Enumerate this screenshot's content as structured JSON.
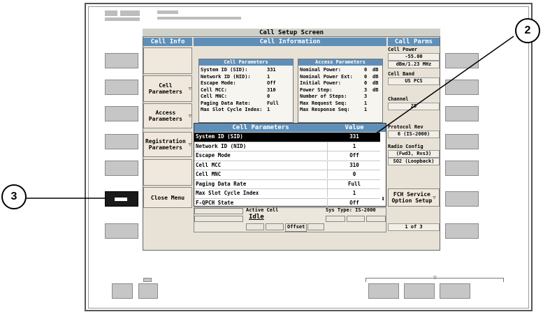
{
  "screen_title": "Call Setup Screen",
  "left_header": "Cell Info",
  "center_header": "Cell Information",
  "right_header": "Call Parms",
  "softkeys_left": [
    "Cell Parameters",
    "Access Parameters",
    "Registration Parameters",
    "Close Menu"
  ],
  "cell_params_panel": {
    "title": "Cell Parameters",
    "rows": [
      {
        "label": "System ID (SID):",
        "value": "331"
      },
      {
        "label": "Network ID (NID):",
        "value": "1"
      },
      {
        "label": "Escape Mode:",
        "value": "Off"
      },
      {
        "label": "Cell MCC:",
        "value": "310"
      },
      {
        "label": "Cell MNC:",
        "value": "0"
      },
      {
        "label": "Paging Data Rate:",
        "value": "Full"
      },
      {
        "label": "Max Slot Cycle Index:",
        "value": "1"
      }
    ]
  },
  "access_params_panel": {
    "title": "Access Parameters",
    "rows": [
      {
        "label": "Nominal Power:",
        "value": "0",
        "unit": "dB"
      },
      {
        "label": "Nominal Power Ext:",
        "value": "0",
        "unit": "dB"
      },
      {
        "label": "Initial Power:",
        "value": "0",
        "unit": "dB"
      },
      {
        "label": "Power Step:",
        "value": "3",
        "unit": "dB"
      },
      {
        "label": "Number of Steps:",
        "value": "3",
        "unit": ""
      },
      {
        "label": "Max Request Seq:",
        "value": "1",
        "unit": ""
      },
      {
        "label": "Max Response Seq:",
        "value": "1",
        "unit": ""
      }
    ]
  },
  "overlay": {
    "col1": "Cell Parameters",
    "col2": "Value",
    "rows": [
      {
        "label": "System ID (SID)",
        "value": "331"
      },
      {
        "label": "Network ID (NID)",
        "value": "1"
      },
      {
        "label": "Escape Mode",
        "value": "Off"
      },
      {
        "label": "Cell MCC",
        "value": "310"
      },
      {
        "label": "Cell MNC",
        "value": "0"
      },
      {
        "label": "Paging Data Rate",
        "value": "Full"
      },
      {
        "label": "Max Slot Cycle Index",
        "value": "1"
      },
      {
        "label": "F-QPCH State",
        "value": "Off"
      }
    ]
  },
  "right_params": [
    {
      "label": "Cell Power",
      "values": [
        "-55.00",
        "dBm/1.23 MHz"
      ]
    },
    {
      "label": "Cell Band",
      "values": [
        "US PCS"
      ]
    },
    {
      "label": "Channel",
      "values": [
        "25"
      ]
    },
    {
      "label": "Protocol Rev",
      "values": [
        "6 (IS-2000)"
      ]
    },
    {
      "label": "Radio Config",
      "values": [
        "(Fwd3, Rvs3)",
        "SO2 (Loopback)"
      ]
    }
  ],
  "fch_softkey": "FCH Service Option Setup",
  "page_indicator": "1 of 3",
  "status": {
    "active_cell_label": "Active Cell",
    "active_cell_value": "Idle",
    "sys_type": "Sys Type: IS-2000",
    "offset": "Offset"
  },
  "callouts": [
    "2",
    "3"
  ]
}
